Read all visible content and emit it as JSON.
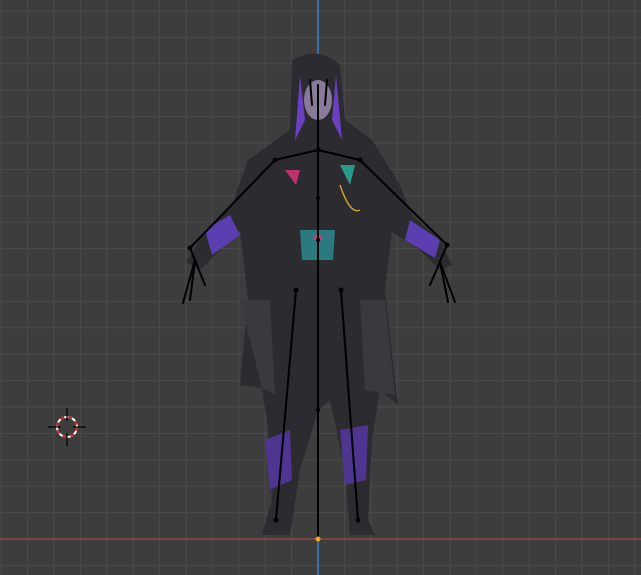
{
  "viewport": {
    "background_color": "#3d3d3d",
    "grid_color": "#4b4b4b",
    "x_axis_color": "#9a4a4a",
    "z_axis_color": "#3f7fc8",
    "armature_color": "#000000",
    "origin_color": "#f5a623"
  },
  "icons": {
    "cursor": "3d-cursor-icon",
    "armature": "armature-bones",
    "mesh": "character-mesh"
  }
}
